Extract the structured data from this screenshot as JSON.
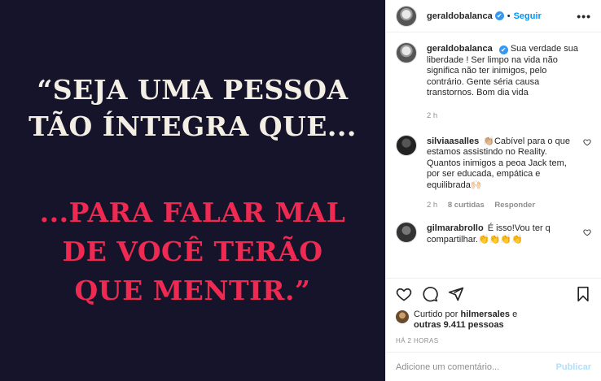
{
  "image": {
    "line1": "“SEJA UMA PESSOA",
    "line2": "TÃO ÍNTEGRA QUE...",
    "line3": "...PARA FALAR MAL",
    "line4": "DE VOCÊ TERÃO",
    "line5": "QUE MENTIR.”",
    "background": "#16142a",
    "text_color": "#f4efe4",
    "accent_color": "#ee2a52"
  },
  "header": {
    "username": "geraldobalanca",
    "verified_icon": "✔",
    "separator": "•",
    "follow_label": "Seguir",
    "more_label": "•••"
  },
  "caption": {
    "username": "geraldobalanca",
    "text": "Sua verdade sua liberdade ! Ser limpo na vida não significa não ter inimigos, pelo contrário. Gente séria causa transtornos. Bom dia vida",
    "time": "2 h"
  },
  "comments": [
    {
      "username": "silviaasalles",
      "text": "👏🏼Cabível para o que estamos assistindo no Reality. Quantos inimigos a peoa Jack tem, por ser educada, empática e equilibrada🙌🏻",
      "time": "2 h",
      "likes": "8 curtidas",
      "reply": "Responder"
    },
    {
      "username": "gilmarabrollo",
      "text": "É isso!Vou ter q compartilhar.👏👏👏👏"
    }
  ],
  "actions": {
    "icons": [
      "heart-icon",
      "comment-icon",
      "share-icon",
      "bookmark-icon"
    ]
  },
  "likes": {
    "prefix": "Curtido por ",
    "user": "hilmersales",
    "middle": " e ",
    "others": "outras 9.411 pessoas"
  },
  "timestamp": "HÁ 2 HORAS",
  "add_comment": {
    "placeholder": "Adicione um comentário...",
    "publish_label": "Publicar"
  },
  "colors": {
    "link_blue": "#0095f6",
    "publish_disabled": "#b2dffc",
    "muted": "#8e8e8e"
  }
}
